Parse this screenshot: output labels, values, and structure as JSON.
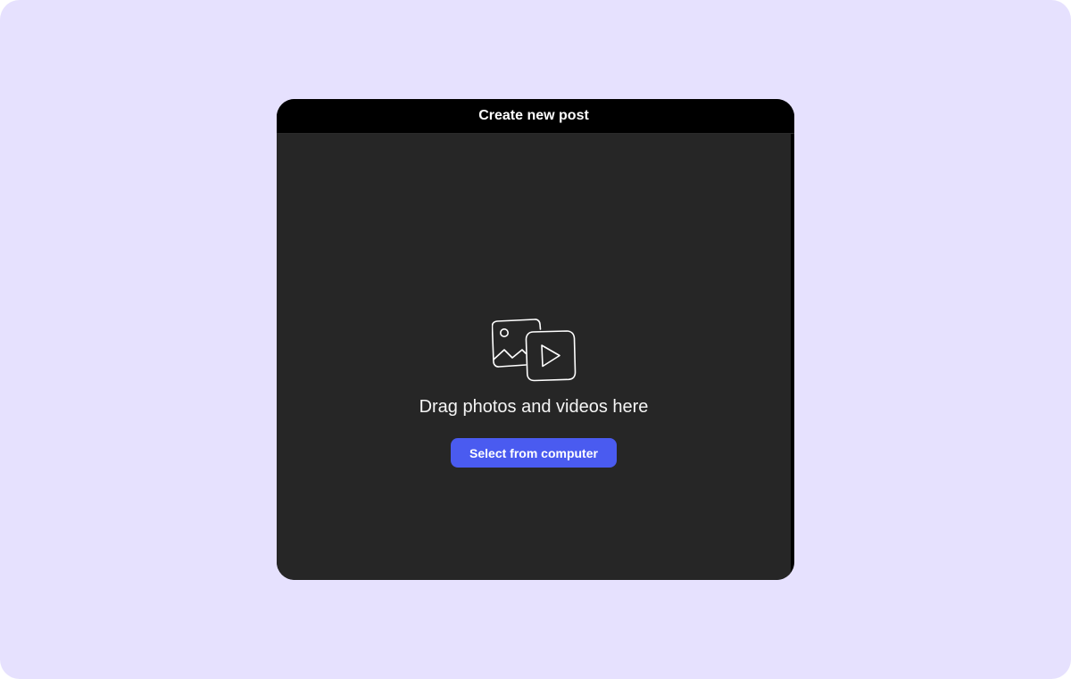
{
  "modal": {
    "title": "Create new post",
    "icon": "photo-video-icon",
    "prompt": "Drag photos and videos here",
    "select_button_label": "Select from computer"
  },
  "colors": {
    "page_background": "#e6e1fe",
    "header_background": "#000000",
    "body_background": "#262626",
    "accent": "#4a5bf0",
    "text": "#ffffff"
  }
}
